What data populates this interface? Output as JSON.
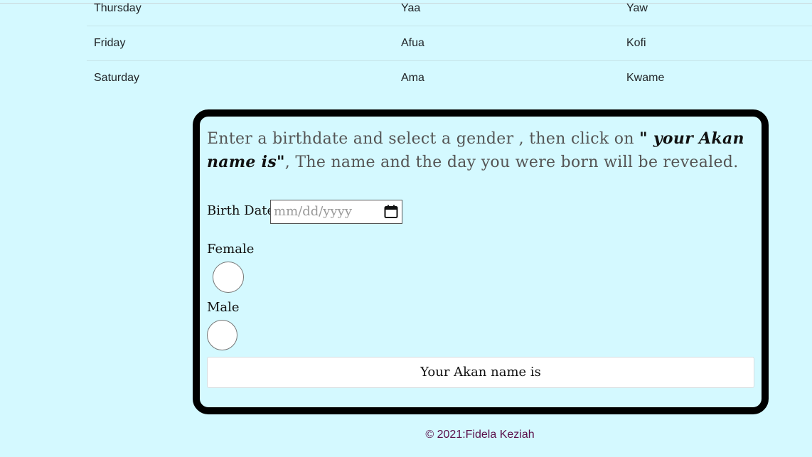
{
  "table": {
    "rows": [
      {
        "day": "Thursday",
        "female": "Yaa",
        "male": "Yaw"
      },
      {
        "day": "Friday",
        "female": "Afua",
        "male": "Kofi"
      },
      {
        "day": "Saturday",
        "female": "Ama",
        "male": "Kwame"
      }
    ]
  },
  "form": {
    "intro_pre": "Enter a birthdate and select a gender , then click on ",
    "intro_emph": "\" your Akan name is\"",
    "intro_post": ", The name and the day you were born will be revealed.",
    "birth_date_label": "Birth Date",
    "birth_date_placeholder": "mm/dd/yyyy",
    "female_label": "Female",
    "male_label": "Male",
    "submit_label": "Your Akan name is"
  },
  "footer": {
    "text": "© 2021:Fidela Keziah"
  },
  "colors": {
    "background": "#d4f9ff",
    "border": "#000000",
    "footer_text": "#5a0f4a"
  }
}
